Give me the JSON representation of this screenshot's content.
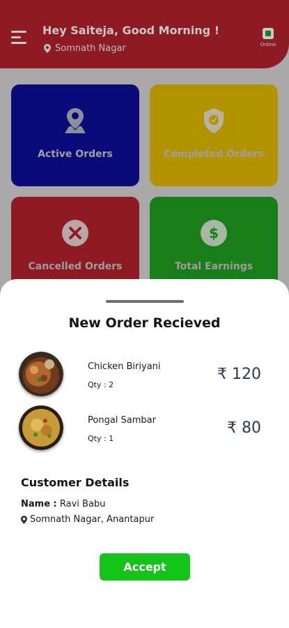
{
  "header": {
    "greeting": "Hey Saiteja, Good Morning !",
    "location": "Somnath Nagar",
    "status_label": "Online"
  },
  "tiles": [
    {
      "label": "Active Orders",
      "icon": "location-pin-icon",
      "color": "#0a0a7a"
    },
    {
      "label": "Completed Orders",
      "icon": "shield-check-icon",
      "color": "#b49300"
    },
    {
      "label": "Cancelled Orders",
      "icon": "close-circle-icon",
      "color": "#8e1a24"
    },
    {
      "label": "Total Earnings",
      "icon": "dollar-circle-icon",
      "color": "#197e19"
    }
  ],
  "sheet": {
    "title": "New Order Recieved",
    "items": [
      {
        "name": "Chicken Biriyani",
        "qty": "Qty : 2",
        "price": "₹ 120"
      },
      {
        "name": "Pongal Sambar",
        "qty": "Qty : 1",
        "price": "₹ 80"
      }
    ],
    "customer": {
      "heading": "Customer Details",
      "name_label": "Name :",
      "name": "Ravi Babu",
      "address": "Somnath Nagar, Anantapur"
    },
    "accept_label": "Accept"
  },
  "colors": {
    "header": "#8e1a24",
    "accept": "#16c31b"
  }
}
